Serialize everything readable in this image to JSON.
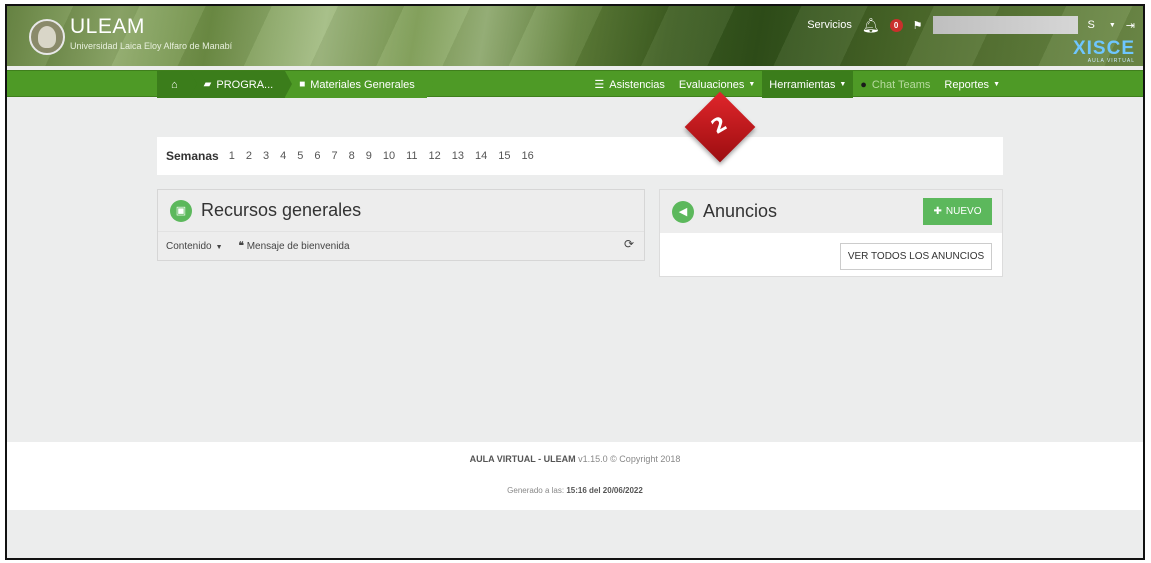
{
  "header": {
    "brand_title": "ULEAM",
    "brand_subtitle": "Universidad Laica Eloy Alfaro de Manabí",
    "services_label": "Servicios",
    "notification_count": "0",
    "user_suffix": "S",
    "logo_text": "XISCE",
    "logo_subtext": "AULA VIRTUAL"
  },
  "breadcrumb": {
    "home_icon": "home-icon",
    "items": [
      "PROGRA...",
      "Materiales Generales"
    ]
  },
  "nav": {
    "asistencias": "Asistencias",
    "evaluaciones": "Evaluaciones",
    "herramientas": "Herramientas",
    "chat_teams": "Chat Teams",
    "reportes": "Reportes"
  },
  "marker": {
    "number": "2"
  },
  "weeks": {
    "label": "Semanas",
    "items": [
      "1",
      "2",
      "3",
      "4",
      "5",
      "6",
      "7",
      "8",
      "9",
      "10",
      "11",
      "12",
      "13",
      "14",
      "15",
      "16"
    ]
  },
  "recursos": {
    "title": "Recursos generales",
    "contenido": "Contenido",
    "mensaje": "Mensaje de bienvenida"
  },
  "anuncios": {
    "title": "Anuncios",
    "new_button": "NUEVO",
    "view_all_button": "VER TODOS LOS ANUNCIOS"
  },
  "footer": {
    "app_name": "AULA VIRTUAL - ULEAM",
    "version_text": "v1.15.0 © Copyright 2018",
    "generated_label": "Generado a las:",
    "generated_value": "15:16 del 20/06/2022"
  },
  "colors": {
    "nav_green": "#4e9a26",
    "nav_active": "#3b7d1b",
    "button_green": "#5cb85c",
    "marker_red": "#d9232a"
  }
}
